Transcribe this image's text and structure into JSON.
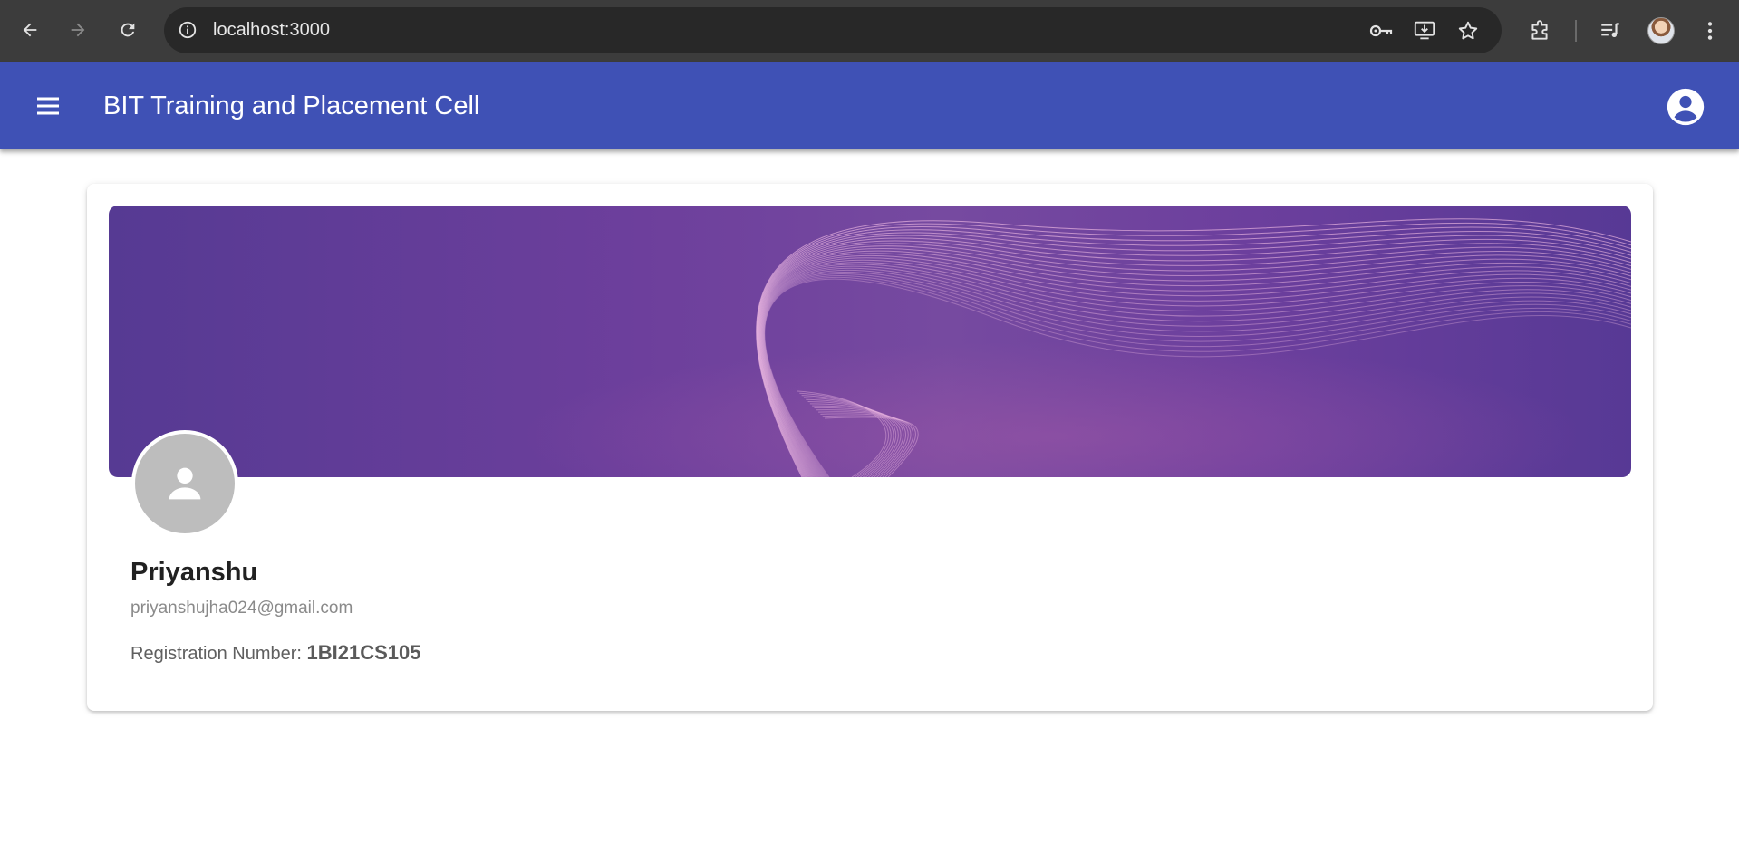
{
  "browser": {
    "url": "localhost:3000",
    "icons": [
      "back-arrow-icon",
      "forward-arrow-icon",
      "reload-icon",
      "site-info-icon",
      "password-key-icon",
      "install-app-icon",
      "bookmark-star-icon",
      "extensions-icon",
      "media-controls-icon",
      "profile-avatar",
      "more-options-icon"
    ]
  },
  "app_bar": {
    "title": "BIT Training and Placement Cell",
    "color": "#3f51b5"
  },
  "profile": {
    "name": "Priyanshu",
    "email": "priyanshujha024@gmail.com",
    "registration_label": "Registration Number:",
    "registration_number": "1BI21CS105"
  }
}
